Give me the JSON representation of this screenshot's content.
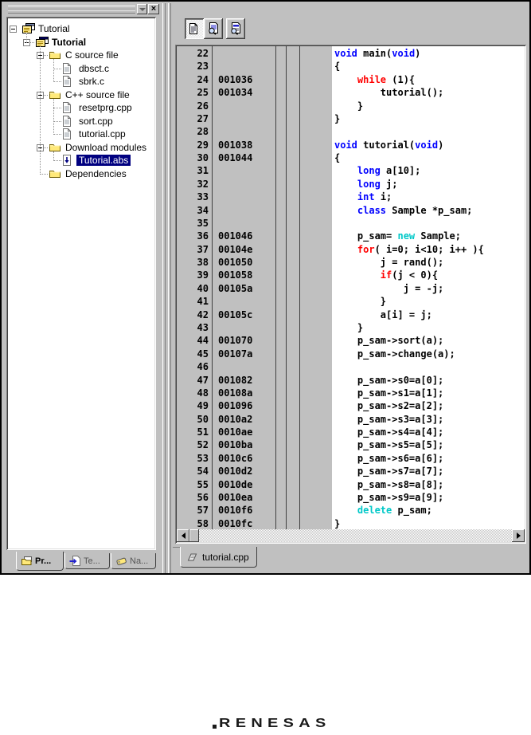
{
  "panel_controls": {
    "close_glyph": "×"
  },
  "workspace_panel": {
    "tree": [
      {
        "label": "Tutorial",
        "level": 0,
        "icon": "workspace-icon",
        "expander": true
      },
      {
        "label": "Tutorial",
        "level": 1,
        "icon": "project-icon",
        "expander": true,
        "bold": true
      },
      {
        "label": "C source file",
        "level": 2,
        "icon": "folder-icon",
        "expander": true
      },
      {
        "label": "dbsct.c",
        "level": 3,
        "icon": "file-icon"
      },
      {
        "label": "sbrk.c",
        "level": 3,
        "icon": "file-icon"
      },
      {
        "label": "C++ source file",
        "level": 2,
        "icon": "folder-icon",
        "expander": true
      },
      {
        "label": "resetprg.cpp",
        "level": 3,
        "icon": "file-icon"
      },
      {
        "label": "sort.cpp",
        "level": 3,
        "icon": "file-icon"
      },
      {
        "label": "tutorial.cpp",
        "level": 3,
        "icon": "file-icon"
      },
      {
        "label": "Download modules",
        "level": 2,
        "icon": "folder-icon",
        "expander": true
      },
      {
        "label": "Tutorial.abs",
        "level": 3,
        "icon": "download-icon",
        "selected": true
      },
      {
        "label": "Dependencies",
        "level": 2,
        "icon": "folder-icon"
      }
    ],
    "tabs": [
      {
        "label": "Pr...",
        "icon": "projects-icon",
        "active": true
      },
      {
        "label": "Te...",
        "icon": "templates-icon",
        "active": false
      },
      {
        "label": "Na...",
        "icon": "navigation-icon",
        "active": false
      }
    ]
  },
  "editor": {
    "toolbar": [
      {
        "name": "view-source-button",
        "icon": "source-document-icon",
        "pressed": true
      },
      {
        "name": "view-mixed-button",
        "icon": "document-magnifier-icon",
        "pressed": false
      },
      {
        "name": "view-disassembly-button",
        "icon": "disassembly-magnifier-icon",
        "pressed": false
      }
    ],
    "tab_label": "tutorial.cpp",
    "tab_icon": "source-file-icon",
    "code_lines": [
      {
        "n": "22",
        "a": "",
        "s": [
          [
            "void",
            "k"
          ],
          [
            " main(",
            "p"
          ],
          [
            "void",
            "k"
          ],
          [
            ")",
            "p"
          ]
        ]
      },
      {
        "n": "23",
        "a": "",
        "s": [
          [
            "{",
            "p"
          ]
        ]
      },
      {
        "n": "24",
        "a": "001036",
        "s": [
          [
            "    ",
            "p"
          ],
          [
            "while",
            "c"
          ],
          [
            " (1){",
            "p"
          ]
        ]
      },
      {
        "n": "25",
        "a": "001034",
        "s": [
          [
            "        tutorial();",
            "p"
          ]
        ]
      },
      {
        "n": "26",
        "a": "",
        "s": [
          [
            "    }",
            "p"
          ]
        ]
      },
      {
        "n": "27",
        "a": "",
        "s": [
          [
            "}",
            "p"
          ]
        ]
      },
      {
        "n": "28",
        "a": "",
        "s": []
      },
      {
        "n": "29",
        "a": "001038",
        "s": [
          [
            "void",
            "k"
          ],
          [
            " tutorial(",
            "p"
          ],
          [
            "void",
            "k"
          ],
          [
            ")",
            "p"
          ]
        ]
      },
      {
        "n": "30",
        "a": "001044",
        "s": [
          [
            "{",
            "p"
          ]
        ]
      },
      {
        "n": "31",
        "a": "",
        "s": [
          [
            "    ",
            "p"
          ],
          [
            "long",
            "k"
          ],
          [
            " a[10];",
            "p"
          ]
        ]
      },
      {
        "n": "32",
        "a": "",
        "s": [
          [
            "    ",
            "p"
          ],
          [
            "long",
            "k"
          ],
          [
            " j;",
            "p"
          ]
        ]
      },
      {
        "n": "33",
        "a": "",
        "s": [
          [
            "    ",
            "p"
          ],
          [
            "int",
            "k"
          ],
          [
            " i;",
            "p"
          ]
        ]
      },
      {
        "n": "34",
        "a": "",
        "s": [
          [
            "    ",
            "p"
          ],
          [
            "class",
            "k"
          ],
          [
            " Sample *p_sam;",
            "p"
          ]
        ]
      },
      {
        "n": "35",
        "a": "",
        "s": []
      },
      {
        "n": "36",
        "a": "001046",
        "s": [
          [
            "    p_sam= ",
            "p"
          ],
          [
            "new",
            "m"
          ],
          [
            " Sample;",
            "p"
          ]
        ]
      },
      {
        "n": "37",
        "a": "00104e",
        "s": [
          [
            "    ",
            "p"
          ],
          [
            "for",
            "c"
          ],
          [
            "( i=0; i<10; i++ ){",
            "p"
          ]
        ]
      },
      {
        "n": "38",
        "a": "001050",
        "s": [
          [
            "        j = rand();",
            "p"
          ]
        ]
      },
      {
        "n": "39",
        "a": "001058",
        "s": [
          [
            "        ",
            "p"
          ],
          [
            "if",
            "c"
          ],
          [
            "(j < 0){",
            "p"
          ]
        ]
      },
      {
        "n": "40",
        "a": "00105a",
        "s": [
          [
            "            j = -j;",
            "p"
          ]
        ]
      },
      {
        "n": "41",
        "a": "",
        "s": [
          [
            "        }",
            "p"
          ]
        ]
      },
      {
        "n": "42",
        "a": "00105c",
        "s": [
          [
            "        a[i] = j;",
            "p"
          ]
        ]
      },
      {
        "n": "43",
        "a": "",
        "s": [
          [
            "    }",
            "p"
          ]
        ]
      },
      {
        "n": "44",
        "a": "001070",
        "s": [
          [
            "    p_sam->sort(a);",
            "p"
          ]
        ]
      },
      {
        "n": "45",
        "a": "00107a",
        "s": [
          [
            "    p_sam->change(a);",
            "p"
          ]
        ]
      },
      {
        "n": "46",
        "a": "",
        "s": []
      },
      {
        "n": "47",
        "a": "001082",
        "s": [
          [
            "    p_sam->s0=a[0];",
            "p"
          ]
        ]
      },
      {
        "n": "48",
        "a": "00108a",
        "s": [
          [
            "    p_sam->s1=a[1];",
            "p"
          ]
        ]
      },
      {
        "n": "49",
        "a": "001096",
        "s": [
          [
            "    p_sam->s2=a[2];",
            "p"
          ]
        ]
      },
      {
        "n": "50",
        "a": "0010a2",
        "s": [
          [
            "    p_sam->s3=a[3];",
            "p"
          ]
        ]
      },
      {
        "n": "51",
        "a": "0010ae",
        "s": [
          [
            "    p_sam->s4=a[4];",
            "p"
          ]
        ]
      },
      {
        "n": "52",
        "a": "0010ba",
        "s": [
          [
            "    p_sam->s5=a[5];",
            "p"
          ]
        ]
      },
      {
        "n": "53",
        "a": "0010c6",
        "s": [
          [
            "    p_sam->s6=a[6];",
            "p"
          ]
        ]
      },
      {
        "n": "54",
        "a": "0010d2",
        "s": [
          [
            "    p_sam->s7=a[7];",
            "p"
          ]
        ]
      },
      {
        "n": "55",
        "a": "0010de",
        "s": [
          [
            "    p_sam->s8=a[8];",
            "p"
          ]
        ]
      },
      {
        "n": "56",
        "a": "0010ea",
        "s": [
          [
            "    p_sam->s9=a[9];",
            "p"
          ]
        ]
      },
      {
        "n": "57",
        "a": "0010f6",
        "s": [
          [
            "    ",
            "p"
          ],
          [
            "delete",
            "m"
          ],
          [
            " p_sam;",
            "p"
          ]
        ]
      },
      {
        "n": "58",
        "a": "0010fc",
        "s": [
          [
            "}",
            "p"
          ]
        ]
      }
    ]
  },
  "colors": {
    "keyword": "#0000ff",
    "control": "#ff0000",
    "storage": "#00c8c8",
    "selection": "#000080",
    "chrome": "#c0c0c0"
  },
  "logo": {
    "text": "RENESAS"
  }
}
